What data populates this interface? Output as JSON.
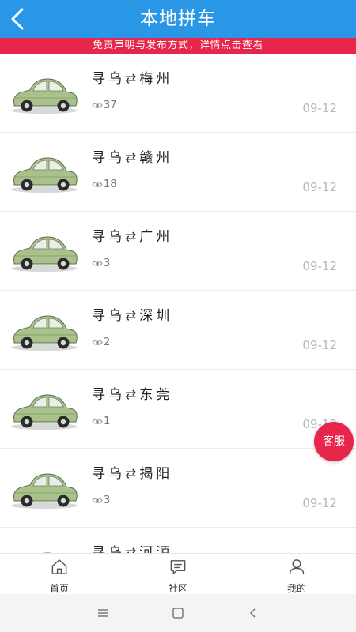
{
  "header": {
    "title": "本地拼车",
    "back_icon": "chevron-left-icon"
  },
  "notice": {
    "text": "免责声明与发布方式，详情点击查看"
  },
  "list": [
    {
      "route": "寻乌⇄梅州",
      "views": "37",
      "date": "09-12"
    },
    {
      "route": "寻乌⇄赣州",
      "views": "18",
      "date": "09-12"
    },
    {
      "route": "寻乌⇄广州",
      "views": "3",
      "date": "09-12"
    },
    {
      "route": "寻乌⇄深圳",
      "views": "2",
      "date": "09-12"
    },
    {
      "route": "寻乌⇄东莞",
      "views": "1",
      "date": "09-12"
    },
    {
      "route": "寻乌⇄揭阳",
      "views": "3",
      "date": "09-12"
    },
    {
      "route": "寻乌⇄河源",
      "views": "",
      "date": ""
    }
  ],
  "customer_service": {
    "label": "客服"
  },
  "tabbar": [
    {
      "label": "首页",
      "icon": "home-icon"
    },
    {
      "label": "社区",
      "icon": "message-icon"
    },
    {
      "label": "我的",
      "icon": "user-icon"
    }
  ],
  "system_nav": {
    "icons": [
      "menu-icon",
      "home-square-icon",
      "back-icon"
    ]
  },
  "colors": {
    "header": "#2a97e6",
    "accent": "#e8254a",
    "date": "#b5b5bf"
  }
}
